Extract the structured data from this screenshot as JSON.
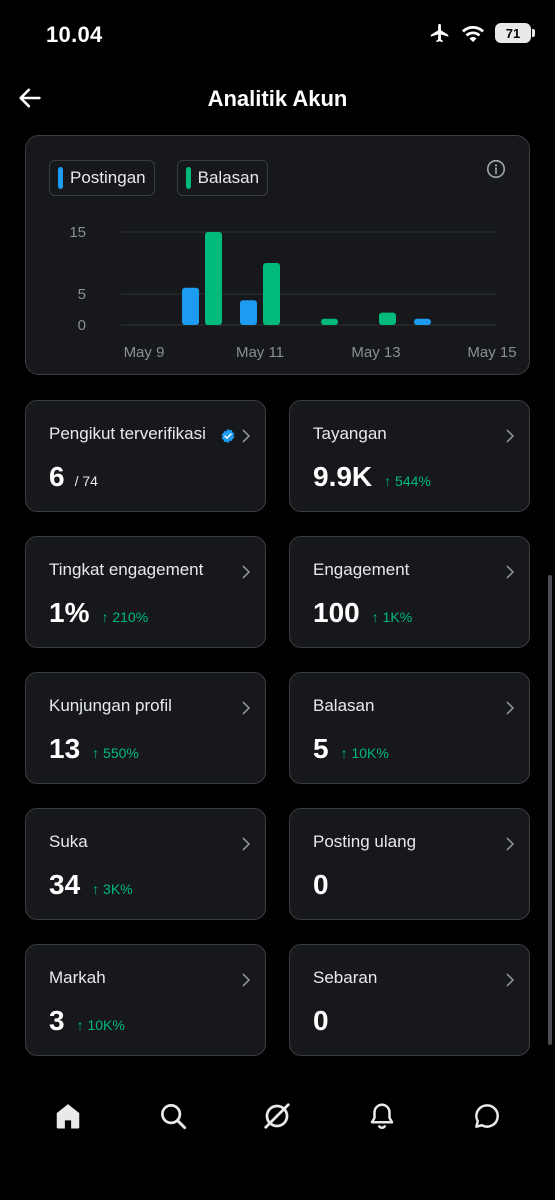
{
  "status": {
    "time": "10.04",
    "battery": "71"
  },
  "header": {
    "title": "Analitik Akun"
  },
  "colors": {
    "posts": "#1d9bf0",
    "replies": "#00ba7c",
    "accent_up": "#00ba7c"
  },
  "legend": [
    {
      "label": "Postingan"
    },
    {
      "label": "Balasan"
    }
  ],
  "chart_data": {
    "type": "bar",
    "y_ticks": [
      "15",
      "5",
      "0"
    ],
    "x_ticks": [
      "May 9",
      "May 11",
      "May 13",
      "May 15"
    ],
    "ylim": [
      0,
      15
    ],
    "series": [
      {
        "name": "Postingan",
        "color": "#1d9bf0",
        "points": [
          {
            "x": "May 10",
            "y": 6
          },
          {
            "x": "May 11",
            "y": 4
          },
          {
            "x": "May 14",
            "y": 1
          }
        ]
      },
      {
        "name": "Balasan",
        "color": "#00ba7c",
        "points": [
          {
            "x": "May 10",
            "y": 15
          },
          {
            "x": "May 11",
            "y": 10
          },
          {
            "x": "May 12",
            "y": 1
          },
          {
            "x": "May 13",
            "y": 2
          }
        ]
      }
    ]
  },
  "metrics": {
    "verified_followers": {
      "label": "Pengikut terverifikasi",
      "value": "6",
      "sub": "/ 74"
    },
    "impressions": {
      "label": "Tayangan",
      "value": "9.9K",
      "change": "↑ 544%"
    },
    "engagement_rate": {
      "label": "Tingkat engagement",
      "value": "1%",
      "change": "↑ 210%"
    },
    "engagements": {
      "label": "Engagement",
      "value": "100",
      "change": "↑ 1K%"
    },
    "profile_visits": {
      "label": "Kunjungan profil",
      "value": "13",
      "change": "↑ 550%"
    },
    "replies": {
      "label": "Balasan",
      "value": "5",
      "change": "↑ 10K%"
    },
    "likes": {
      "label": "Suka",
      "value": "34",
      "change": "↑ 3K%"
    },
    "reposts": {
      "label": "Posting ulang",
      "value": "0"
    },
    "bookmarks": {
      "label": "Markah",
      "value": "3",
      "change": "↑ 10K%"
    },
    "shares": {
      "label": "Sebaran",
      "value": "0"
    }
  },
  "nav": [
    {
      "icon": "home-icon"
    },
    {
      "icon": "search-icon"
    },
    {
      "icon": "grok-icon"
    },
    {
      "icon": "bell-icon"
    },
    {
      "icon": "message-icon"
    }
  ]
}
